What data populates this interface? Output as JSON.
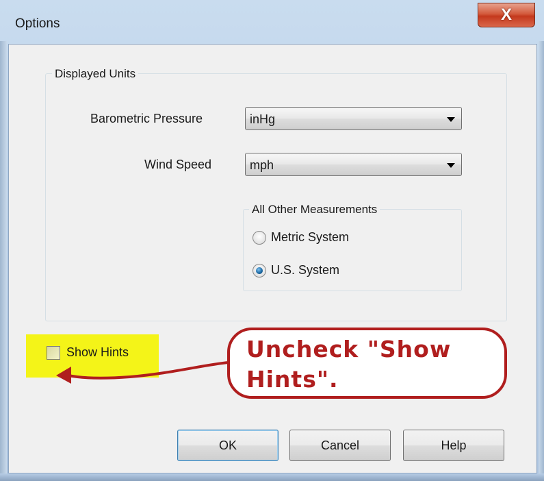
{
  "window": {
    "title": "Options",
    "close_label": "X"
  },
  "displayed_units": {
    "legend": "Displayed Units",
    "barometric_pressure": {
      "label": "Barometric Pressure",
      "value": "inHg"
    },
    "wind_speed": {
      "label": "Wind Speed",
      "value": "mph"
    },
    "other_measurements": {
      "legend": "All Other Measurements",
      "options": [
        {
          "label": "Metric System",
          "selected": false
        },
        {
          "label": "U.S. System",
          "selected": true
        }
      ]
    }
  },
  "show_hints": {
    "label": "Show Hints",
    "checked": false
  },
  "annotation": {
    "text": "Uncheck \"Show Hints\".",
    "color": "#b01e1e",
    "highlight_color": "#f4f418"
  },
  "buttons": {
    "ok": "OK",
    "cancel": "Cancel",
    "help": "Help"
  }
}
